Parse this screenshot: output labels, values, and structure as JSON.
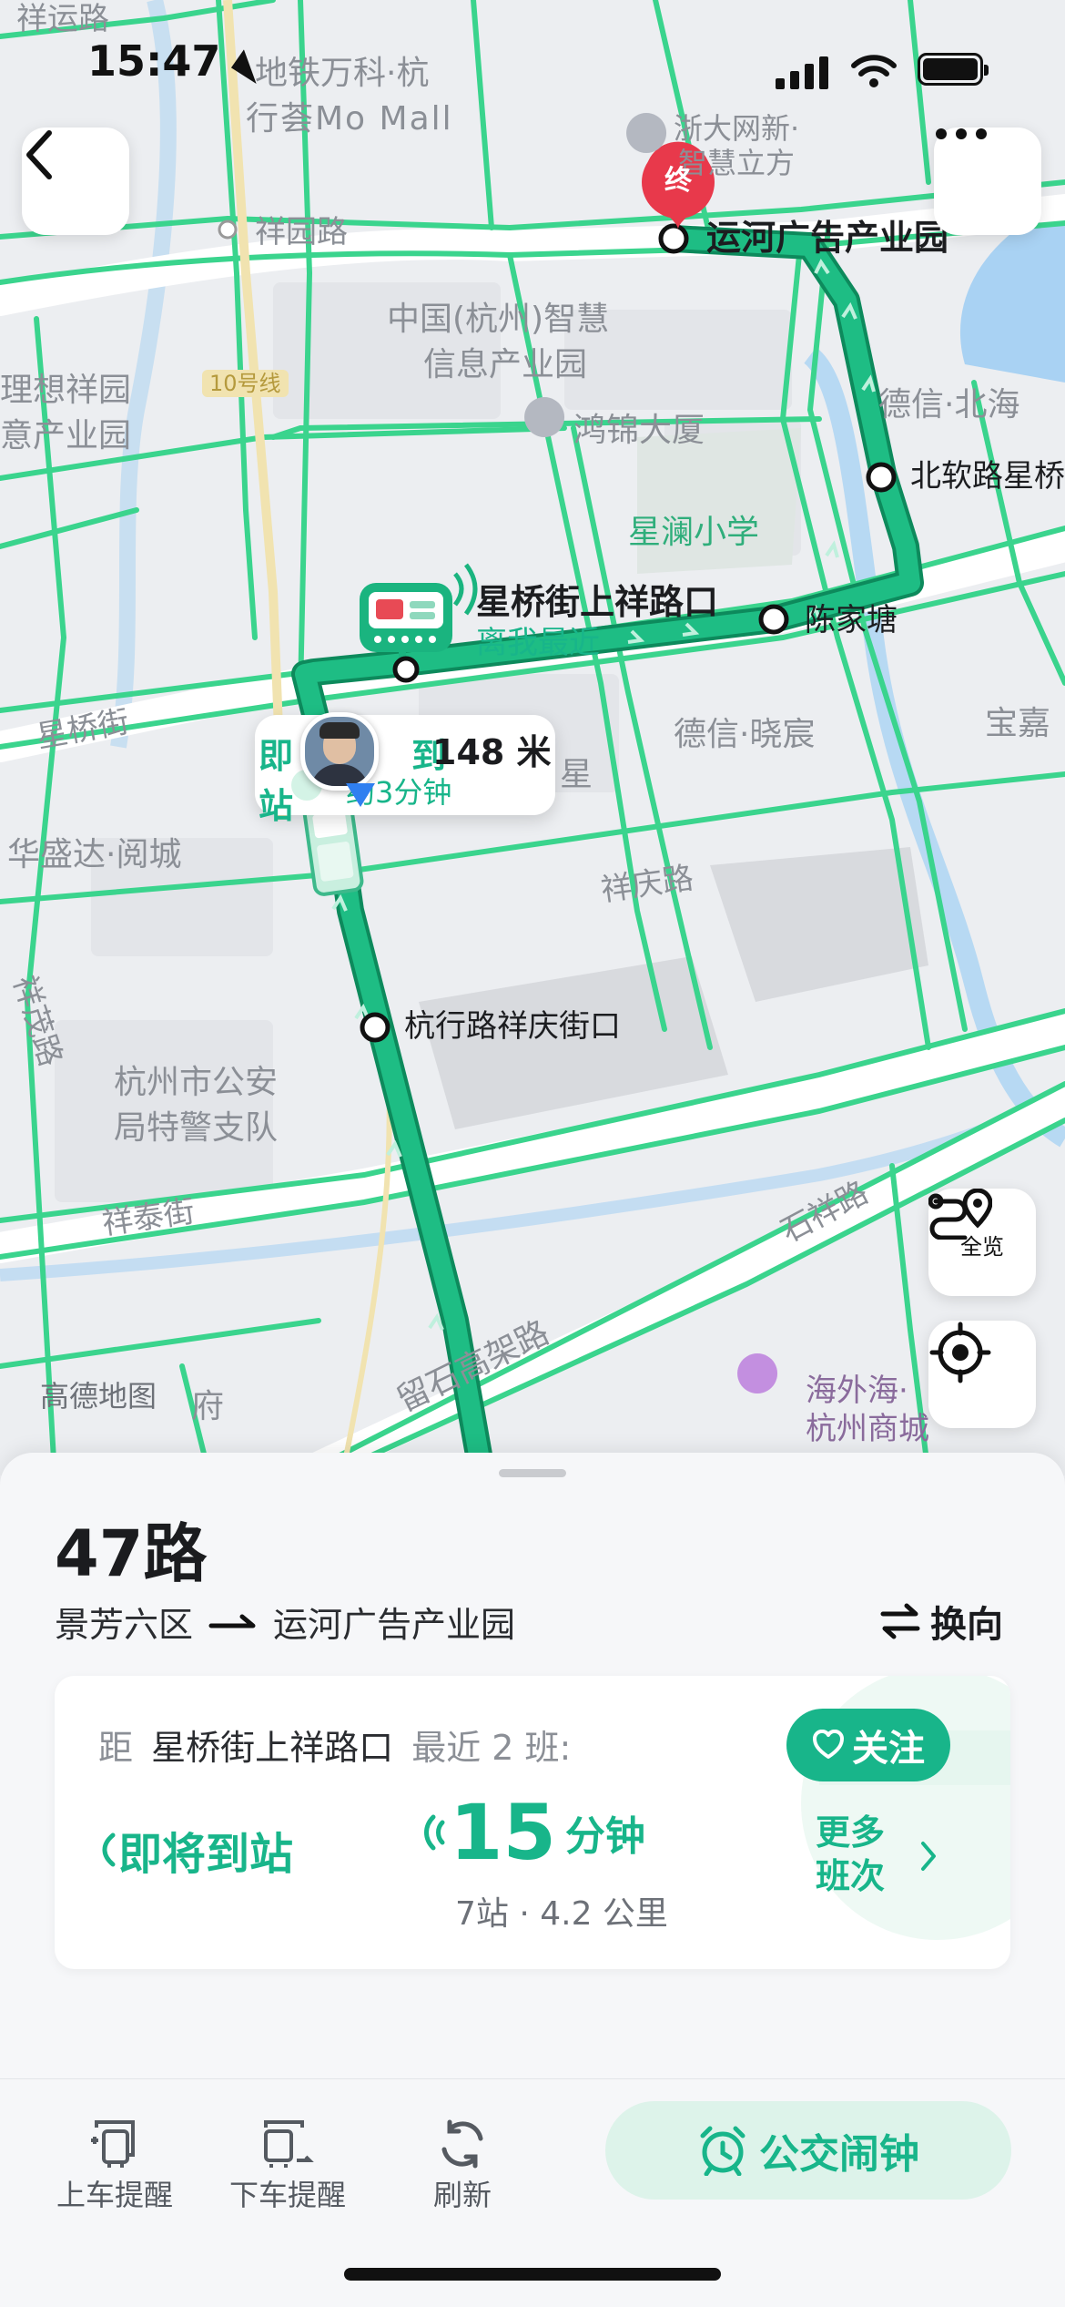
{
  "status_bar": {
    "time": "15:47"
  },
  "map": {
    "labels": {
      "xiangyun_road": "祥运路",
      "metro_mall_1": "地铁万科·杭",
      "metro_mall_2": "行荟Mo Mall",
      "zheda_1": "浙大网新·",
      "zheda_2": "智慧立方",
      "xiangyuan_road": "祥园路",
      "smart_park_1": "中国(杭州)智慧",
      "smart_park_2": "信息产业园",
      "ideal_1": "理想祥园",
      "ideal_2": "意产业园",
      "line10": "10号线",
      "hongjin": "鸿锦大厦",
      "dexin_north": "德信·北海",
      "xinglan_school": "星澜小学",
      "xingqiao_street": "星桥街",
      "dexin_xiaochen": "德信·晓宸",
      "baojia": "宝嘉",
      "huashengda": "华盛达·阅城",
      "xingqing_road": "祥庆路",
      "xiangmao_road": "祥茂路",
      "police_1": "杭州市公安",
      "police_2": "局特警支队",
      "xiangtai_street": "祥泰街",
      "shixiang_road": "石祥路",
      "liushi_viaduct": "留石高架路",
      "amap_logo": "高德地图",
      "fu": "府",
      "haiwaihai_1": "海外海·",
      "haiwaihai_2": "杭州商城",
      "xing_fragment": "星",
      "near_fragment": "距",
      "end_marker": "终"
    },
    "stops": {
      "end": "运河广告产业园",
      "beiruan": "北软路星桥",
      "chenjiatang": "陈家塘",
      "current": "星桥街上祥路口",
      "current_tag": "离我最近",
      "hangxing": "杭行路祥庆街口"
    },
    "bubble": {
      "status": "即将到站",
      "distance": "148 米",
      "eta": "约3分钟"
    },
    "overview_label": "全览"
  },
  "route": {
    "name": "47路",
    "from": "景芳六区",
    "to": "运河广告产业园",
    "reverse_label": "换向"
  },
  "card": {
    "prefix": "距",
    "stop": "星桥街上祥路口",
    "recent": "最近 2 班:",
    "follow_label": "关注",
    "bus1": "即将到站",
    "bus2_minutes": "15",
    "bus2_unit": "分钟",
    "bus2_detail": "7站 · 4.2 公里",
    "more_1": "更多",
    "more_2": "班次"
  },
  "tabbar": {
    "board_remind": "上车提醒",
    "alight_remind": "下车提醒",
    "refresh": "刷新",
    "alarm": "公交闹钟"
  },
  "colors": {
    "route": "#1aae78",
    "accent": "#18b58a",
    "road": "#3cd48f",
    "end_marker": "#e8394b"
  }
}
